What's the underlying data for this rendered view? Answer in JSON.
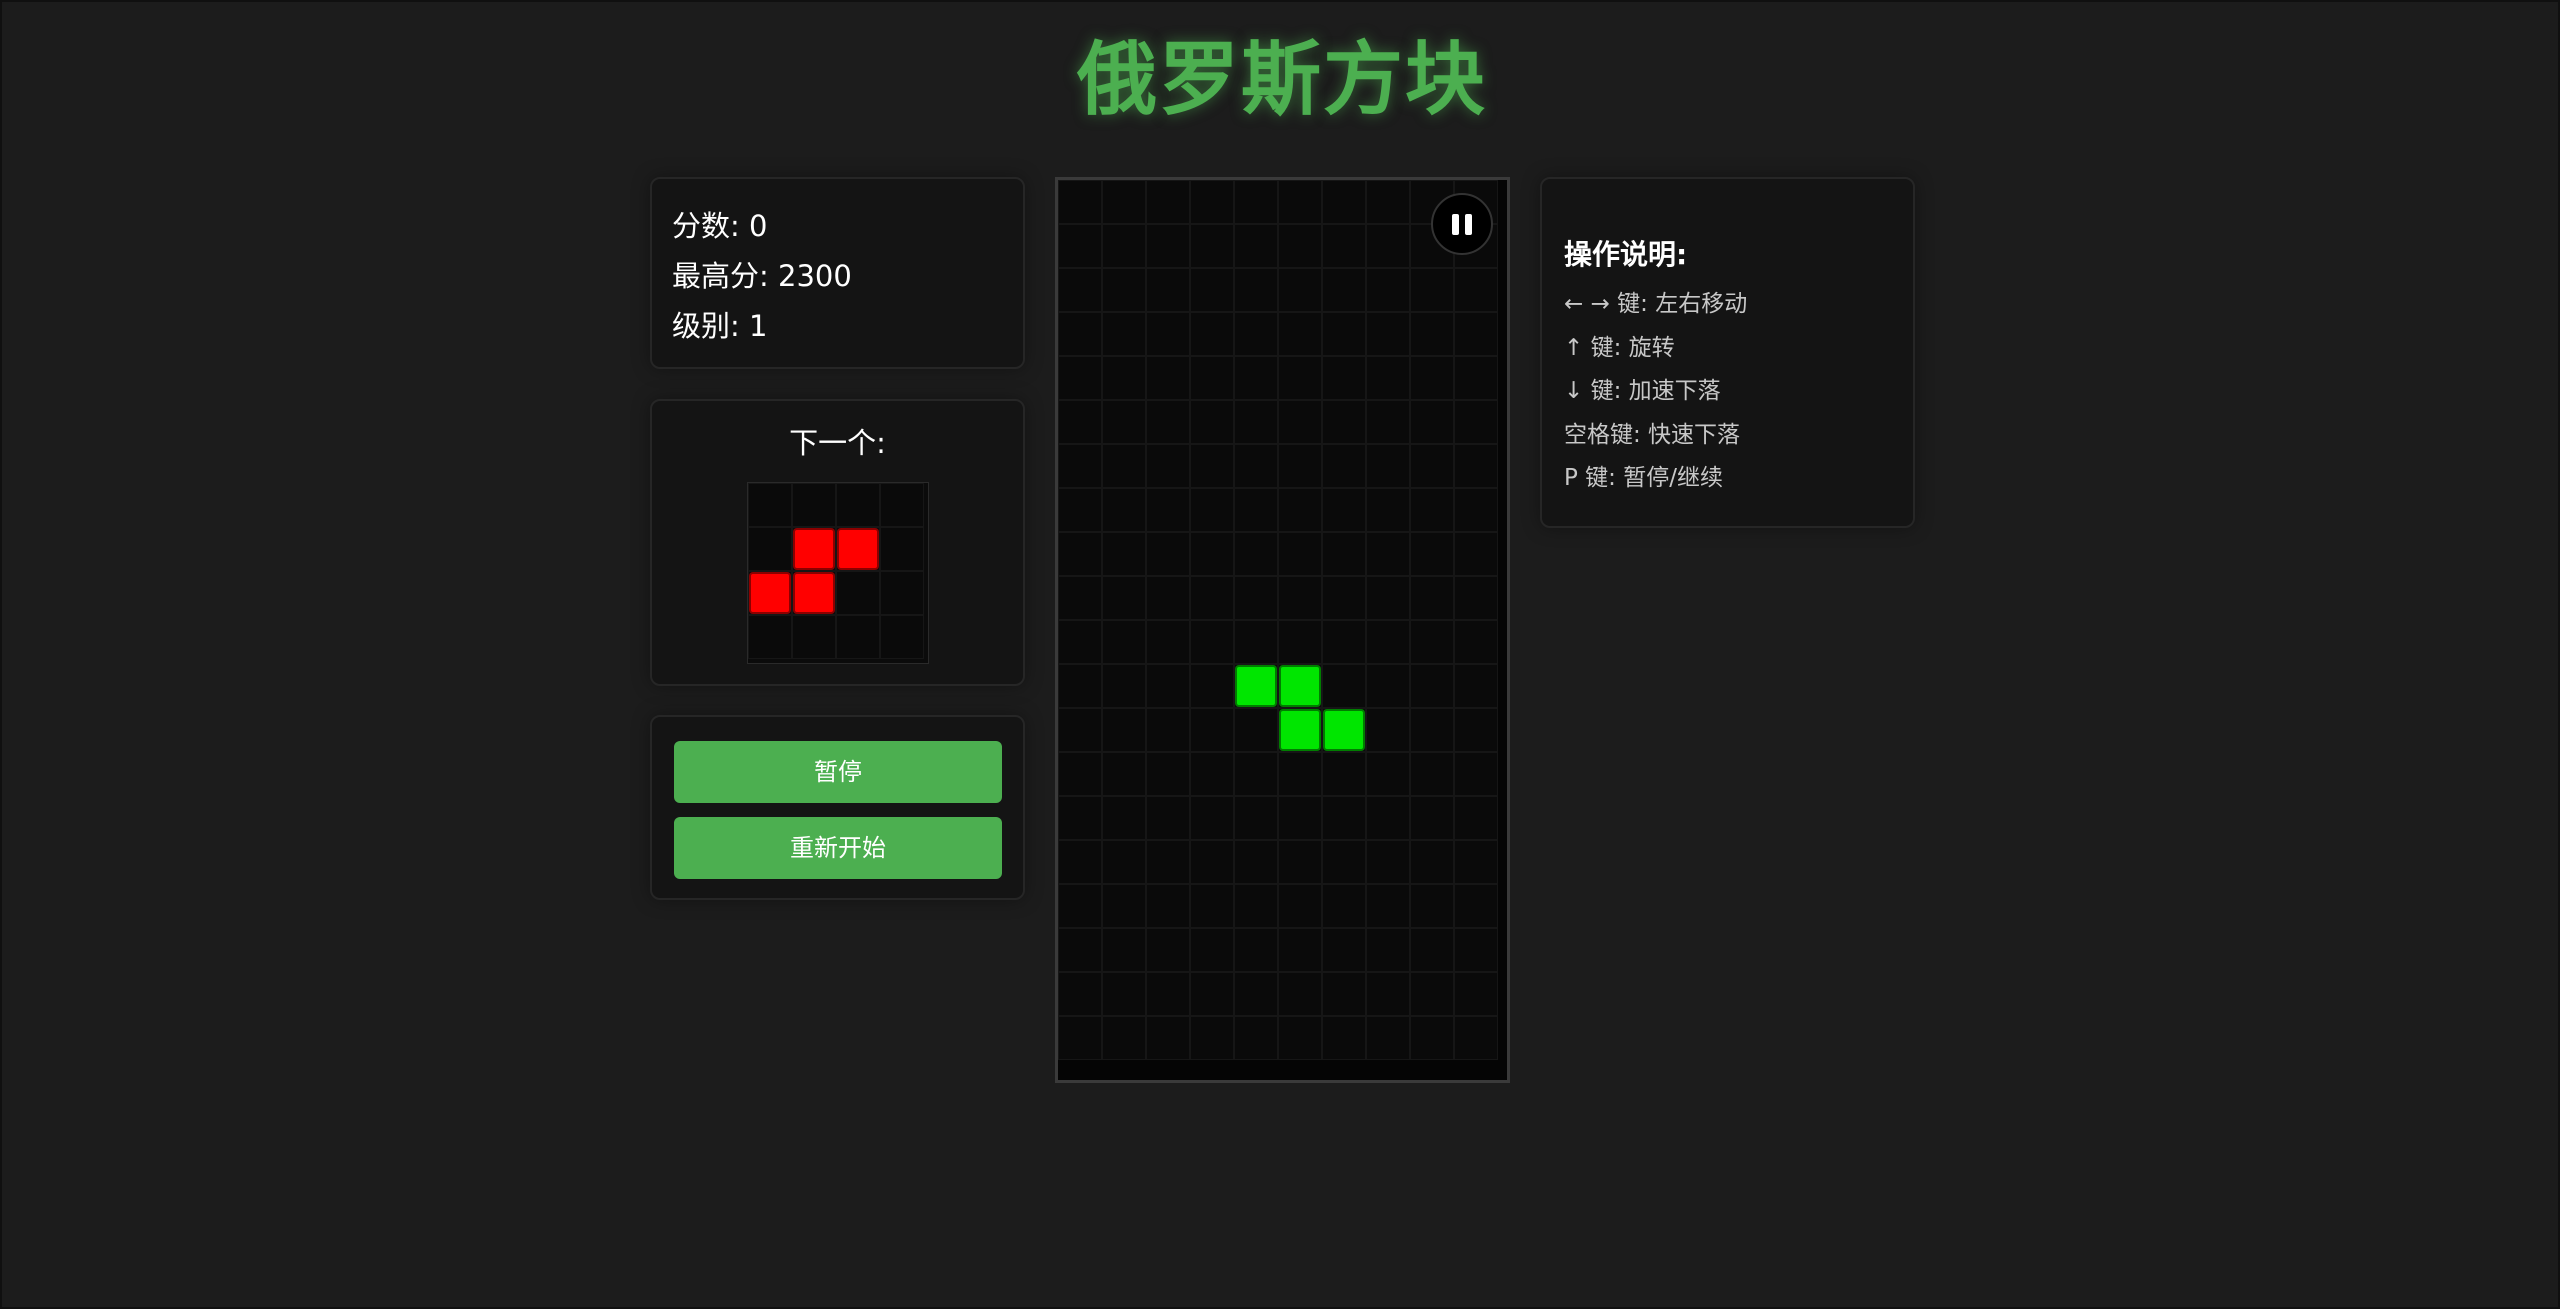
{
  "title": "俄罗斯方块",
  "stats": {
    "score_label": "分数: ",
    "score": "0",
    "high_label": "最高分: ",
    "high": "2300",
    "level_label": "级别: ",
    "level": "1"
  },
  "next": {
    "label": "下一个:",
    "rows": 4,
    "cols": 4,
    "color": "#ff0000",
    "cells": [
      [
        1,
        1
      ],
      [
        1,
        2
      ],
      [
        2,
        0
      ],
      [
        2,
        1
      ]
    ]
  },
  "buttons": {
    "pause_label": "暂停",
    "restart_label": "重新开始"
  },
  "board": {
    "rows": 20,
    "cols": 10,
    "active_color": "#00e600",
    "active_cells": [
      [
        11,
        4
      ],
      [
        11,
        5
      ],
      [
        12,
        5
      ],
      [
        12,
        6
      ]
    ],
    "pause_icon": "pause-icon"
  },
  "help": {
    "title": "操作说明:",
    "items": [
      "← → 键: 左右移动",
      "↑ 键: 旋转",
      "↓ 键: 加速下落",
      "空格键: 快速下落",
      "P 键: 暂停/继续"
    ]
  },
  "colors": {
    "accent": "#4caf50",
    "background": "#1c1c1c",
    "panel": "#141414"
  }
}
